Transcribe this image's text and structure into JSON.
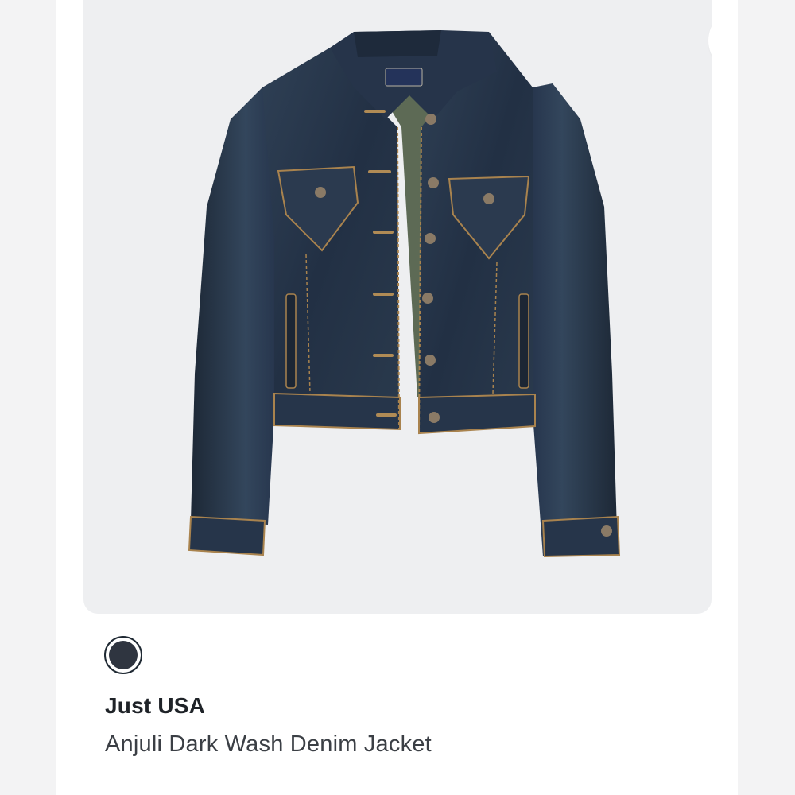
{
  "product": {
    "brand": "Just USA",
    "name": "Anjuli Dark Wash Denim Jacket",
    "swatch_color": "#2f3540"
  },
  "actions": {
    "more_icon": "more-horizontal-icon"
  },
  "colors": {
    "card_bg": "#eeeff1",
    "more_dots": "#1e3a74",
    "denim_dark": "#1f2b3a",
    "denim_mid": "#2c3b4e",
    "stitch": "#a9834e",
    "lining": "#5d6a55"
  }
}
